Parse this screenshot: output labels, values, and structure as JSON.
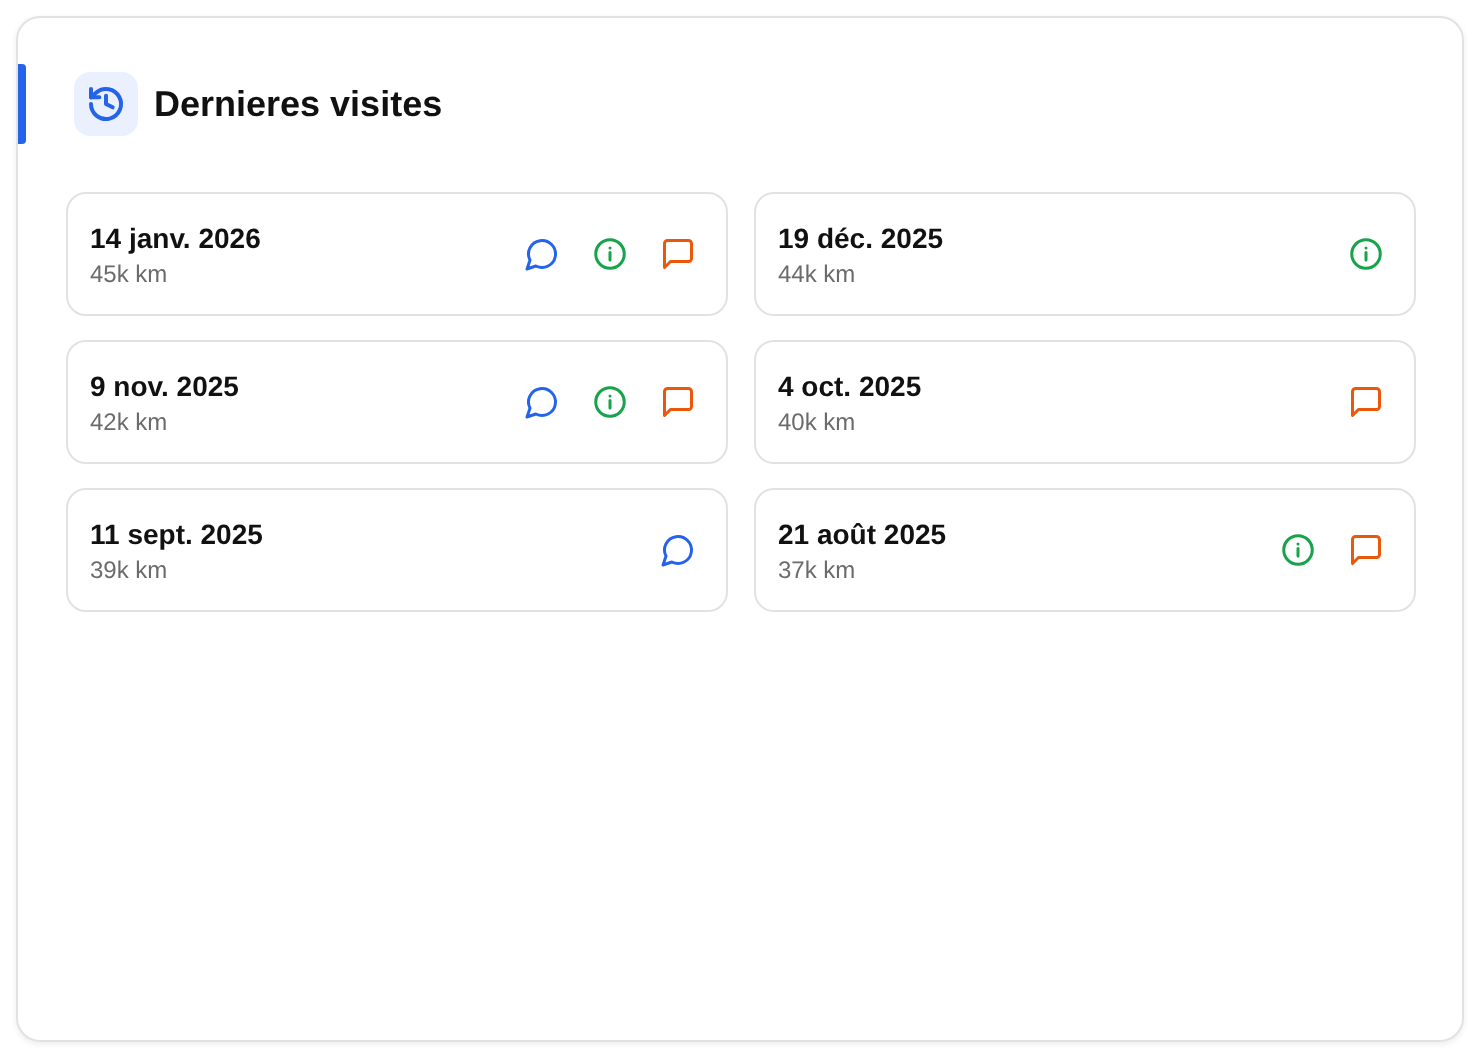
{
  "panel": {
    "title": "Dernieres visites"
  },
  "visits": [
    {
      "date": "14 janv. 2026",
      "mileage": "45k km",
      "round_comment": true,
      "info": true,
      "square_comment": true
    },
    {
      "date": "19 déc. 2025",
      "mileage": "44k km",
      "round_comment": false,
      "info": true,
      "square_comment": false
    },
    {
      "date": "9 nov. 2025",
      "mileage": "42k km",
      "round_comment": true,
      "info": true,
      "square_comment": true
    },
    {
      "date": "4 oct. 2025",
      "mileage": "40k km",
      "round_comment": false,
      "info": false,
      "square_comment": true
    },
    {
      "date": "11 sept. 2025",
      "mileage": "39k km",
      "round_comment": true,
      "info": false,
      "square_comment": false
    },
    {
      "date": "21 août 2025",
      "mileage": "37k km",
      "round_comment": false,
      "info": true,
      "square_comment": true
    }
  ]
}
